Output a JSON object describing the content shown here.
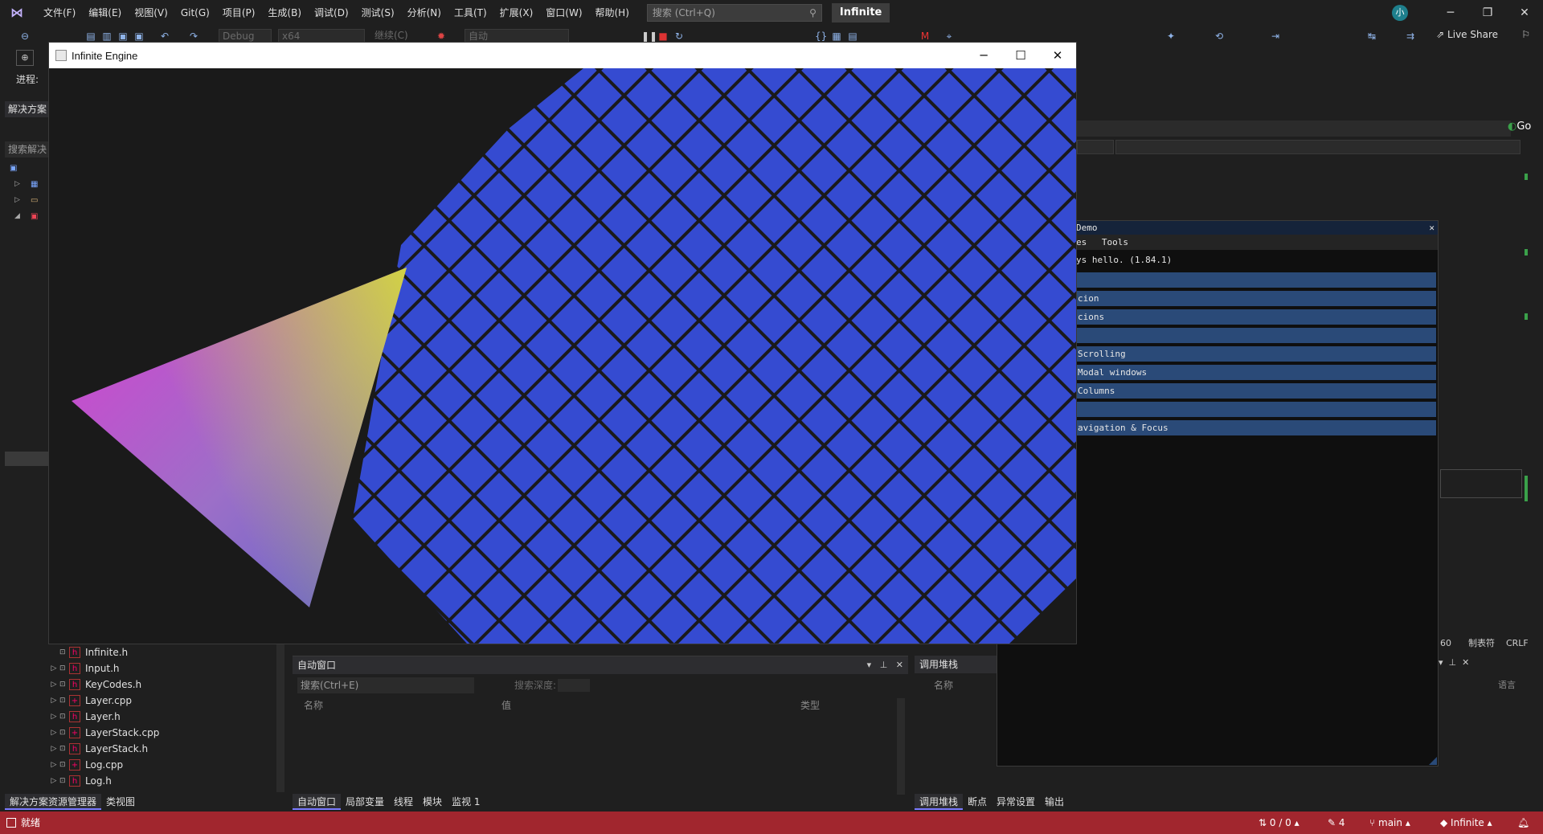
{
  "menubar": {
    "items": [
      "文件(F)",
      "编辑(E)",
      "视图(V)",
      "Git(G)",
      "项目(P)",
      "生成(B)",
      "调试(D)",
      "测试(S)",
      "分析(N)",
      "工具(T)",
      "扩展(X)",
      "窗口(W)",
      "帮助(H)"
    ],
    "search_placeholder": "搜索 (Ctrl+Q)",
    "solution_name": "Infinite",
    "avatar": "小"
  },
  "toolbar": {
    "config": "Debug",
    "platform": "x64",
    "continue": "继续(C)",
    "auto": "自动",
    "live_share": "Live Share"
  },
  "left_panel": {
    "progress": "进程:",
    "header": "解决方案",
    "search": "搜索解决",
    "files": [
      {
        "name": "Infinite.h",
        "icon": "header-file-icon",
        "expandable": false
      },
      {
        "name": "Input.h",
        "icon": "header-file-icon",
        "expandable": true
      },
      {
        "name": "KeyCodes.h",
        "icon": "header-file-icon",
        "expandable": true
      },
      {
        "name": "Layer.cpp",
        "icon": "cpp-file-icon",
        "expandable": true
      },
      {
        "name": "Layer.h",
        "icon": "header-file-icon",
        "expandable": true
      },
      {
        "name": "LayerStack.cpp",
        "icon": "cpp-file-icon",
        "expandable": true
      },
      {
        "name": "LayerStack.h",
        "icon": "header-file-icon",
        "expandable": true
      },
      {
        "name": "Log.cpp",
        "icon": "cpp-file-icon",
        "expandable": true
      },
      {
        "name": "Log.h",
        "icon": "header-file-icon",
        "expandable": true
      }
    ],
    "tabs": [
      "解决方案资源管理器",
      "类视图"
    ]
  },
  "auto_window": {
    "title": "自动窗口",
    "search": "搜索(Ctrl+E)",
    "depth_label": "搜索深度:",
    "columns": [
      "名称",
      "值",
      "类型"
    ],
    "tabs": [
      "自动窗口",
      "局部变量",
      "线程",
      "模块",
      "监视 1"
    ]
  },
  "callstack": {
    "title": "调用堆栈",
    "column": "名称",
    "tabs": [
      "调用堆栈",
      "断点",
      "异常设置",
      "输出"
    ]
  },
  "right_panel": {
    "go": "Go",
    "status_line": "60",
    "tab_label": "制表符",
    "eol": "CRLF",
    "lang": "语言"
  },
  "engine_window": {
    "title": "Infinite Engine",
    "grid_color": "#354bd1",
    "line_color": "#1a1a1a"
  },
  "imgui_demo": {
    "title": "Demo",
    "menu": [
      "es",
      "Tools"
    ],
    "hello": "ys hello. (1.84.1)",
    "headers": [
      "",
      "cion",
      "cions",
      "",
      "Scrolling",
      "Modal windows",
      "Columns",
      "",
      "avigation & Focus"
    ]
  },
  "statusbar": {
    "ready": "就绪",
    "changes": "0 / 0",
    "edits": "4",
    "branch": "main",
    "repo": "Infinite",
    "color": "#a1262e"
  }
}
